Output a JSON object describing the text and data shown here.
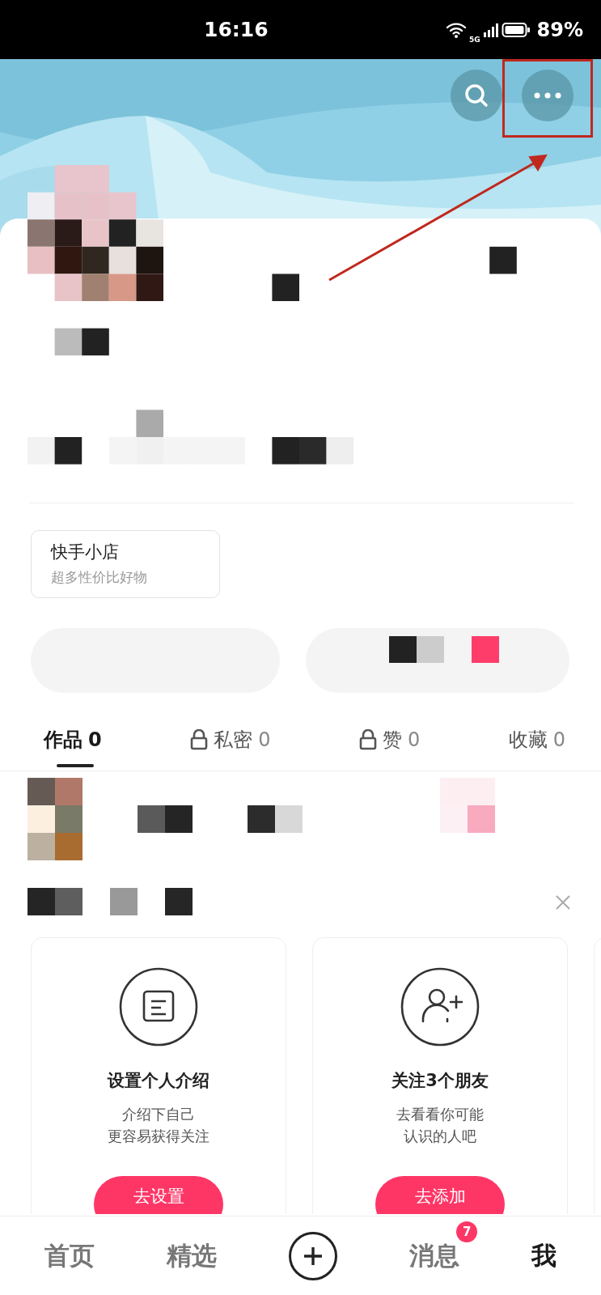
{
  "status_bar": {
    "time": "16:16",
    "network": "5G",
    "battery": "89%"
  },
  "header_buttons": [
    {
      "kind": "search"
    },
    {
      "kind": "more"
    }
  ],
  "shop": {
    "title": "快手小店",
    "subtitle": "超多性价比好物"
  },
  "tabs": [
    {
      "label": "作品",
      "count": "0",
      "selected": true,
      "locked": false
    },
    {
      "label": "私密",
      "count": "0",
      "selected": false,
      "locked": true
    },
    {
      "label": "赞",
      "count": "0",
      "selected": false,
      "locked": true
    },
    {
      "label": "收藏",
      "count": "0",
      "selected": false,
      "locked": false
    }
  ],
  "suggestions": [
    {
      "kind": "note",
      "title": "设置个人介绍",
      "lines": [
        "介绍下自己",
        "更容易获得关注"
      ],
      "button": "去设置"
    },
    {
      "kind": "add-user",
      "title": "关注3个朋友",
      "lines": [
        "去看看你可能",
        "认识的人吧"
      ],
      "button": "去添加"
    }
  ],
  "nav": [
    {
      "kind": "text",
      "label": "首页",
      "selected": false
    },
    {
      "kind": "text",
      "label": "精选",
      "selected": false
    },
    {
      "kind": "create"
    },
    {
      "kind": "text",
      "label": "消息",
      "badge": "7",
      "selected": false
    },
    {
      "kind": "text",
      "label": "我",
      "selected": true
    }
  ]
}
